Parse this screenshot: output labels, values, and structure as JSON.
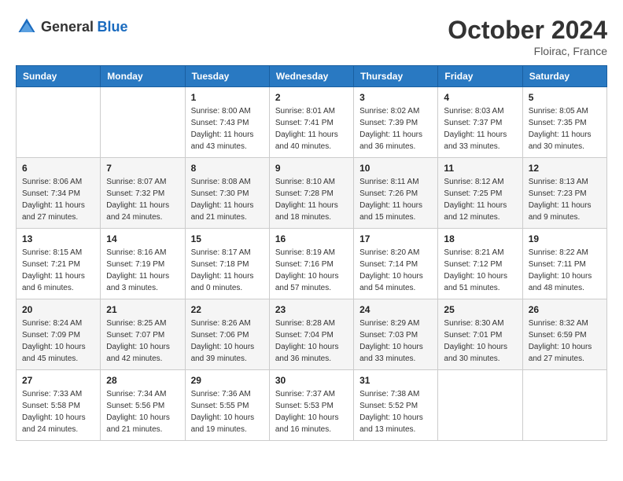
{
  "header": {
    "logo": {
      "general": "General",
      "blue": "Blue"
    },
    "month": "October 2024",
    "location": "Floirac, France"
  },
  "calendar": {
    "weekdays": [
      "Sunday",
      "Monday",
      "Tuesday",
      "Wednesday",
      "Thursday",
      "Friday",
      "Saturday"
    ],
    "weeks": [
      [
        {
          "day": null,
          "info": null
        },
        {
          "day": null,
          "info": null
        },
        {
          "day": "1",
          "info": "Sunrise: 8:00 AM\nSunset: 7:43 PM\nDaylight: 11 hours and 43 minutes."
        },
        {
          "day": "2",
          "info": "Sunrise: 8:01 AM\nSunset: 7:41 PM\nDaylight: 11 hours and 40 minutes."
        },
        {
          "day": "3",
          "info": "Sunrise: 8:02 AM\nSunset: 7:39 PM\nDaylight: 11 hours and 36 minutes."
        },
        {
          "day": "4",
          "info": "Sunrise: 8:03 AM\nSunset: 7:37 PM\nDaylight: 11 hours and 33 minutes."
        },
        {
          "day": "5",
          "info": "Sunrise: 8:05 AM\nSunset: 7:35 PM\nDaylight: 11 hours and 30 minutes."
        }
      ],
      [
        {
          "day": "6",
          "info": "Sunrise: 8:06 AM\nSunset: 7:34 PM\nDaylight: 11 hours and 27 minutes."
        },
        {
          "day": "7",
          "info": "Sunrise: 8:07 AM\nSunset: 7:32 PM\nDaylight: 11 hours and 24 minutes."
        },
        {
          "day": "8",
          "info": "Sunrise: 8:08 AM\nSunset: 7:30 PM\nDaylight: 11 hours and 21 minutes."
        },
        {
          "day": "9",
          "info": "Sunrise: 8:10 AM\nSunset: 7:28 PM\nDaylight: 11 hours and 18 minutes."
        },
        {
          "day": "10",
          "info": "Sunrise: 8:11 AM\nSunset: 7:26 PM\nDaylight: 11 hours and 15 minutes."
        },
        {
          "day": "11",
          "info": "Sunrise: 8:12 AM\nSunset: 7:25 PM\nDaylight: 11 hours and 12 minutes."
        },
        {
          "day": "12",
          "info": "Sunrise: 8:13 AM\nSunset: 7:23 PM\nDaylight: 11 hours and 9 minutes."
        }
      ],
      [
        {
          "day": "13",
          "info": "Sunrise: 8:15 AM\nSunset: 7:21 PM\nDaylight: 11 hours and 6 minutes."
        },
        {
          "day": "14",
          "info": "Sunrise: 8:16 AM\nSunset: 7:19 PM\nDaylight: 11 hours and 3 minutes."
        },
        {
          "day": "15",
          "info": "Sunrise: 8:17 AM\nSunset: 7:18 PM\nDaylight: 11 hours and 0 minutes."
        },
        {
          "day": "16",
          "info": "Sunrise: 8:19 AM\nSunset: 7:16 PM\nDaylight: 10 hours and 57 minutes."
        },
        {
          "day": "17",
          "info": "Sunrise: 8:20 AM\nSunset: 7:14 PM\nDaylight: 10 hours and 54 minutes."
        },
        {
          "day": "18",
          "info": "Sunrise: 8:21 AM\nSunset: 7:12 PM\nDaylight: 10 hours and 51 minutes."
        },
        {
          "day": "19",
          "info": "Sunrise: 8:22 AM\nSunset: 7:11 PM\nDaylight: 10 hours and 48 minutes."
        }
      ],
      [
        {
          "day": "20",
          "info": "Sunrise: 8:24 AM\nSunset: 7:09 PM\nDaylight: 10 hours and 45 minutes."
        },
        {
          "day": "21",
          "info": "Sunrise: 8:25 AM\nSunset: 7:07 PM\nDaylight: 10 hours and 42 minutes."
        },
        {
          "day": "22",
          "info": "Sunrise: 8:26 AM\nSunset: 7:06 PM\nDaylight: 10 hours and 39 minutes."
        },
        {
          "day": "23",
          "info": "Sunrise: 8:28 AM\nSunset: 7:04 PM\nDaylight: 10 hours and 36 minutes."
        },
        {
          "day": "24",
          "info": "Sunrise: 8:29 AM\nSunset: 7:03 PM\nDaylight: 10 hours and 33 minutes."
        },
        {
          "day": "25",
          "info": "Sunrise: 8:30 AM\nSunset: 7:01 PM\nDaylight: 10 hours and 30 minutes."
        },
        {
          "day": "26",
          "info": "Sunrise: 8:32 AM\nSunset: 6:59 PM\nDaylight: 10 hours and 27 minutes."
        }
      ],
      [
        {
          "day": "27",
          "info": "Sunrise: 7:33 AM\nSunset: 5:58 PM\nDaylight: 10 hours and 24 minutes."
        },
        {
          "day": "28",
          "info": "Sunrise: 7:34 AM\nSunset: 5:56 PM\nDaylight: 10 hours and 21 minutes."
        },
        {
          "day": "29",
          "info": "Sunrise: 7:36 AM\nSunset: 5:55 PM\nDaylight: 10 hours and 19 minutes."
        },
        {
          "day": "30",
          "info": "Sunrise: 7:37 AM\nSunset: 5:53 PM\nDaylight: 10 hours and 16 minutes."
        },
        {
          "day": "31",
          "info": "Sunrise: 7:38 AM\nSunset: 5:52 PM\nDaylight: 10 hours and 13 minutes."
        },
        {
          "day": null,
          "info": null
        },
        {
          "day": null,
          "info": null
        }
      ]
    ]
  }
}
